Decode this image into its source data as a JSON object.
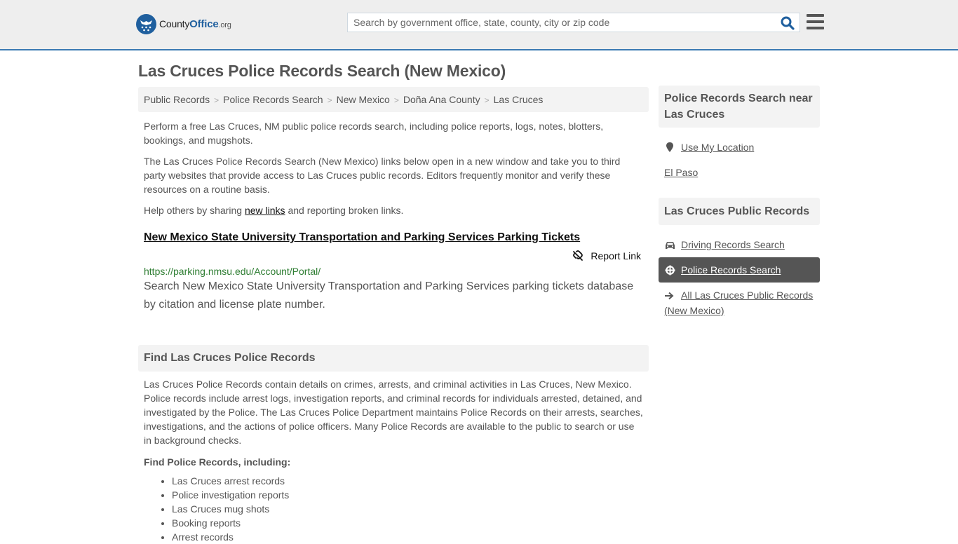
{
  "header": {
    "logo": {
      "name": "County",
      "brand": "Office",
      "tld": ".org"
    },
    "search": {
      "placeholder": "Search by government office, state, county, city or zip code",
      "value": ""
    },
    "colors": {
      "brand": "#1f5f9e",
      "accent_border": "#3b7ab3",
      "topbar_bg": "#eeeeee"
    }
  },
  "page": {
    "title": "Las Cruces Police Records Search (New Mexico)"
  },
  "breadcrumb": [
    {
      "label": "Public Records"
    },
    {
      "label": "Police Records Search"
    },
    {
      "label": "New Mexico"
    },
    {
      "label": "Doña Ana County"
    },
    {
      "label": "Las Cruces"
    }
  ],
  "breadcrumb_separator": ">",
  "intro": {
    "p1": "Perform a free Las Cruces, NM public police records search, including police reports, logs, notes, blotters, bookings, and mugshots.",
    "p2": "The Las Cruces Police Records Search (New Mexico) links below open in a new window and take you to third party websites that provide access to Las Cruces public records. Editors frequently monitor and verify these resources on a routine basis.",
    "p3_before": "Help others by sharing ",
    "p3_link": "new links",
    "p3_after": " and reporting broken links."
  },
  "results": [
    {
      "title": "New Mexico State University Transportation and Parking Services Parking Tickets",
      "report_label": "Report Link",
      "url": "https://parking.nmsu.edu/Account/Portal/",
      "description": "Search New Mexico State University Transportation and Parking Services parking tickets database by citation and license plate number."
    }
  ],
  "find_section": {
    "heading": "Find Las Cruces Police Records",
    "body": "Las Cruces Police Records contain details on crimes, arrests, and criminal activities in Las Cruces, New Mexico. Police records include arrest logs, investigation reports, and criminal records for individuals arrested, detained, and investigated by the Police. The Las Cruces Police Department maintains Police Records on their arrests, searches, investigations, and the actions of police officers. Many Police Records are available to the public to search or use in background checks.",
    "subheading": "Find Police Records, including:",
    "items": [
      "Las Cruces arrest records",
      "Police investigation reports",
      "Las Cruces mug shots",
      "Booking reports",
      "Arrest records"
    ]
  },
  "sidebar": {
    "nearby": {
      "heading": "Police Records Search near Las Cruces",
      "use_location": "Use My Location",
      "places": [
        "El Paso"
      ]
    },
    "public_records": {
      "heading": "Las Cruces Public Records",
      "items": [
        {
          "label": "Driving Records Search",
          "icon": "car-icon",
          "active": false
        },
        {
          "label": "Police Records Search",
          "icon": "crosshair-icon",
          "active": true
        },
        {
          "label": "All Las Cruces Public Records (New Mexico)",
          "icon": "arrow-right-icon",
          "active": false
        }
      ]
    }
  }
}
